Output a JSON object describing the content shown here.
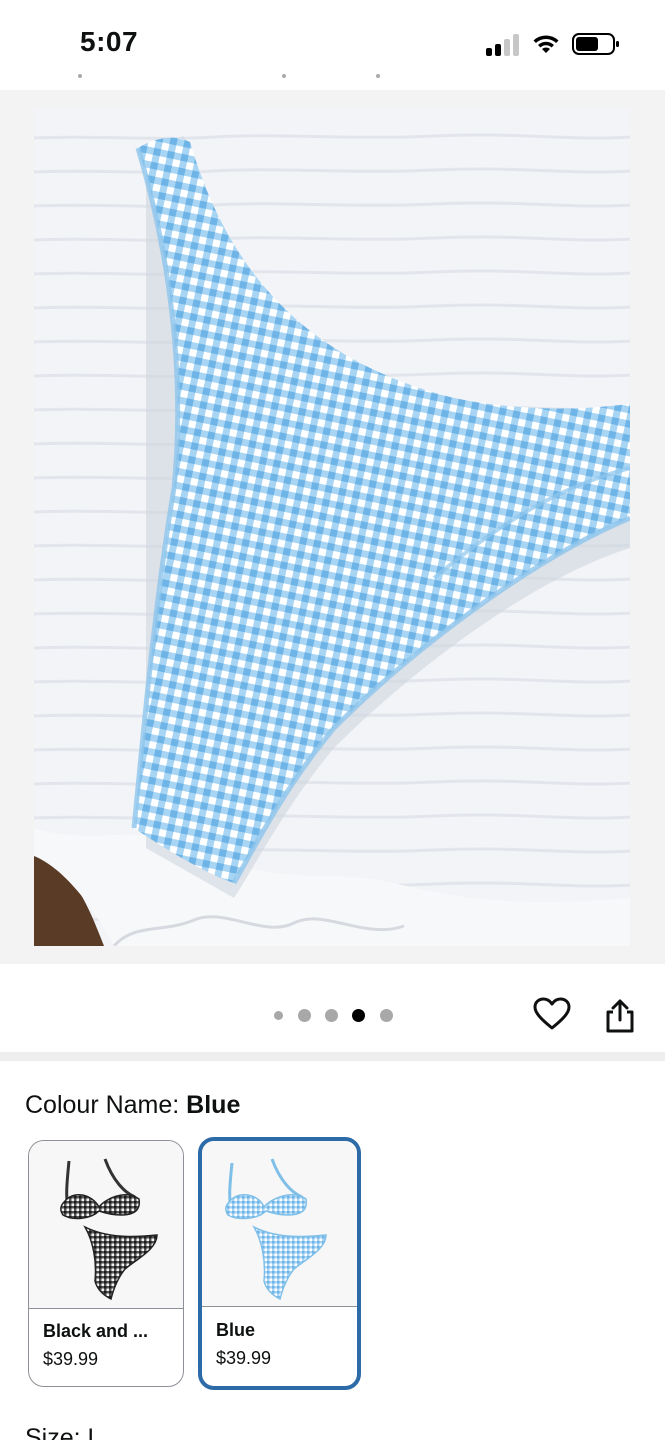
{
  "status_bar": {
    "time": "5:07"
  },
  "gallery": {
    "image_alt": "Blue gingham bikini bottom on white quilted fabric",
    "dot_count": 5,
    "active_dot_index": 3
  },
  "actions": {
    "favorite_icon": "heart-icon",
    "share_icon": "share-icon"
  },
  "variation": {
    "label": "Colour Name: ",
    "selected_value": "Blue",
    "options": [
      {
        "name": "Black and ...",
        "price": "$39.99",
        "selected": false,
        "color": "#3a3a3a"
      },
      {
        "name": "Blue",
        "price": "$39.99",
        "selected": true,
        "color": "#7fbfe8"
      }
    ]
  },
  "next_section_peek": "Size: L",
  "colors": {
    "accent": "#2c6aa8",
    "gingham_blue": "#8ec7ee",
    "text": "#0f1111"
  }
}
